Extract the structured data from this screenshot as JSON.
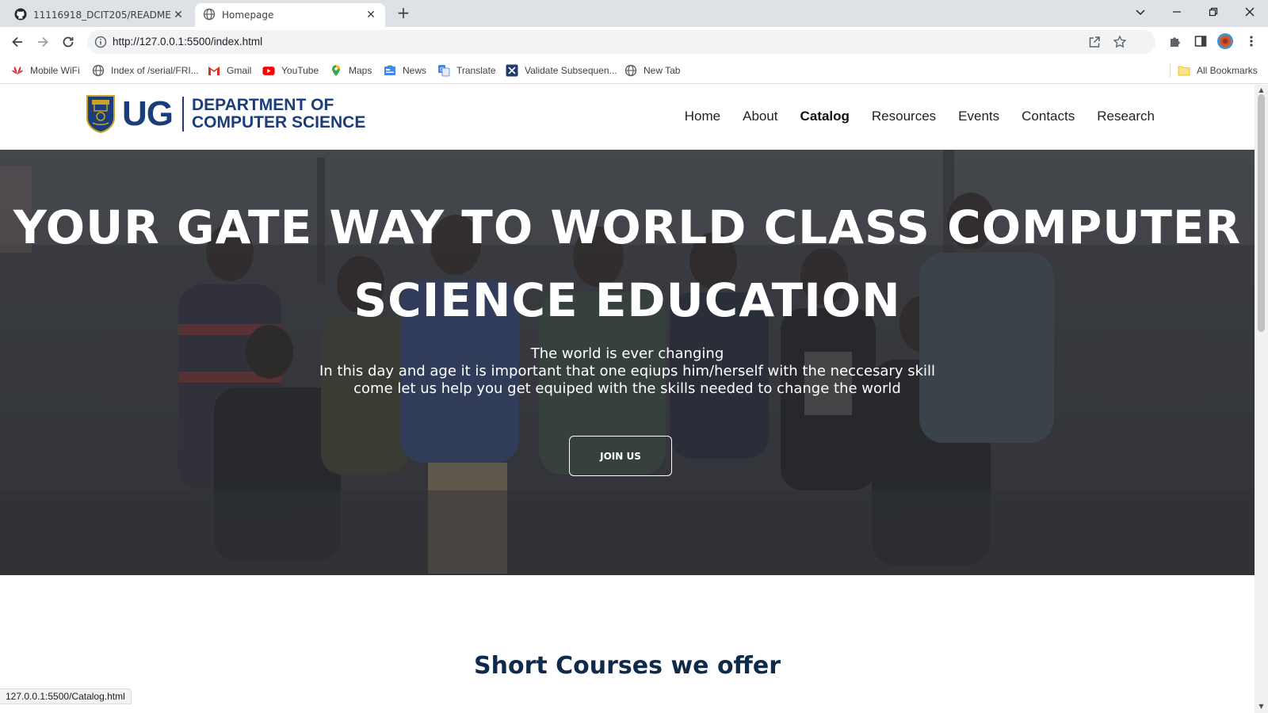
{
  "browser": {
    "tabs": [
      {
        "title": "11116918_DCIT205/README.md",
        "icon": "github-icon",
        "active": false
      },
      {
        "title": "Homepage",
        "icon": "globe-icon",
        "active": true
      }
    ],
    "url": "http://127.0.0.1:5500/index.html",
    "bookmarks": [
      {
        "label": "Mobile WiFi",
        "icon": "huawei-icon"
      },
      {
        "label": "Index of /serial/FRI...",
        "icon": "globe-icon"
      },
      {
        "label": "Gmail",
        "icon": "gmail-icon"
      },
      {
        "label": "YouTube",
        "icon": "youtube-icon"
      },
      {
        "label": "Maps",
        "icon": "maps-icon"
      },
      {
        "label": "News",
        "icon": "news-icon"
      },
      {
        "label": "Translate",
        "icon": "translate-icon"
      },
      {
        "label": "Validate Subsequen...",
        "icon": "leetcode-icon"
      },
      {
        "label": "New Tab",
        "icon": "globe-icon"
      }
    ],
    "all_bookmarks": "All Bookmarks",
    "status_url": "127.0.0.1:5500/Catalog.html"
  },
  "site": {
    "logo_short": "UG",
    "logo_line1": "DEPARTMENT OF",
    "logo_line2": "COMPUTER SCIENCE",
    "nav": [
      {
        "label": "Home",
        "active": false
      },
      {
        "label": "About",
        "active": false
      },
      {
        "label": "Catalog",
        "active": true
      },
      {
        "label": "Resources",
        "active": false
      },
      {
        "label": "Events",
        "active": false
      },
      {
        "label": "Contacts",
        "active": false
      },
      {
        "label": "Research",
        "active": false
      }
    ],
    "hero": {
      "title_line1": "YOUR GATE WAY TO WORLD CLASS COMPUTER",
      "title_line2": "SCIENCE EDUCATION",
      "sub_line1": "The world is ever changing",
      "sub_line2": "In this day and age it is important that one eqiups him/herself with the neccesary skill",
      "sub_line3": "come let us help you get equiped with the skills needed to change the world",
      "button": "JOIN US"
    },
    "courses_title": "Short Courses we offer"
  },
  "colors": {
    "brand": "#1b3d7a",
    "heading": "#0f2a4a",
    "hero_overlay": "#3d3f44"
  }
}
